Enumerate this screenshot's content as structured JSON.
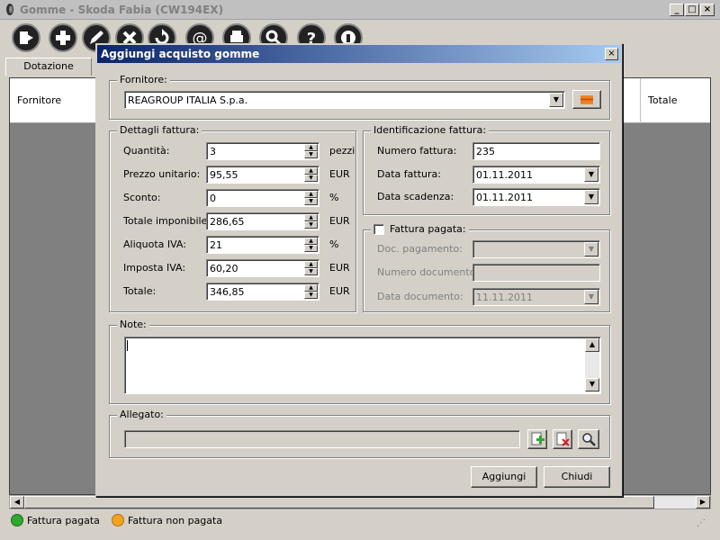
{
  "window": {
    "title": "Gomme - Skoda Fabia (CW194EX)",
    "min": "_",
    "max": "□",
    "close": "×"
  },
  "tabs": [
    {
      "label": "Dotazione"
    }
  ],
  "grid": {
    "columns": [
      "Fornitore",
      "Totale"
    ]
  },
  "legend": {
    "paid": "Fattura pagata",
    "unpaid": "Fattura non pagata",
    "paid_color": "#2ea82e",
    "unpaid_color": "#f4a21d"
  },
  "dialog": {
    "title": "Aggiungi acquisto gomme",
    "close": "×",
    "fornitore": {
      "label": "Fornitore:",
      "value": "REAGROUP ITALIA S.p.a."
    },
    "dettagli": {
      "label": "Dettagli fattura:",
      "rows": [
        {
          "label": "Quantità:",
          "value": "3",
          "unit": "pezzi"
        },
        {
          "label": "Prezzo unitario:",
          "value": "95,55",
          "unit": "EUR"
        },
        {
          "label": "Sconto:",
          "value": "0",
          "unit": "%"
        },
        {
          "label": "Totale imponibile:",
          "value": "286,65",
          "unit": "EUR"
        },
        {
          "label": "Aliquota IVA:",
          "value": "21",
          "unit": "%"
        },
        {
          "label": "Imposta IVA:",
          "value": "60,20",
          "unit": "EUR"
        },
        {
          "label": "Totale:",
          "value": "346,85",
          "unit": "EUR"
        }
      ]
    },
    "identificazione": {
      "label": "Identificazione fattura:",
      "numero_label": "Numero fattura:",
      "numero_value": "235",
      "data_label": "Data fattura:",
      "data_value": "01.11.2011",
      "scadenza_label": "Data scadenza:",
      "scadenza_value": "01.11.2011"
    },
    "pagata": {
      "label": "Fattura pagata:",
      "doc_label": "Doc. pagamento:",
      "doc_value": "",
      "numero_label": "Numero documento:",
      "numero_value": "",
      "data_label": "Data documento:",
      "data_value": "11.11.2011"
    },
    "note": {
      "label": "Note:",
      "value": ""
    },
    "allegato": {
      "label": "Allegato:",
      "value": ""
    },
    "buttons": {
      "add": "Aggiungi",
      "close": "Chiudi"
    }
  }
}
